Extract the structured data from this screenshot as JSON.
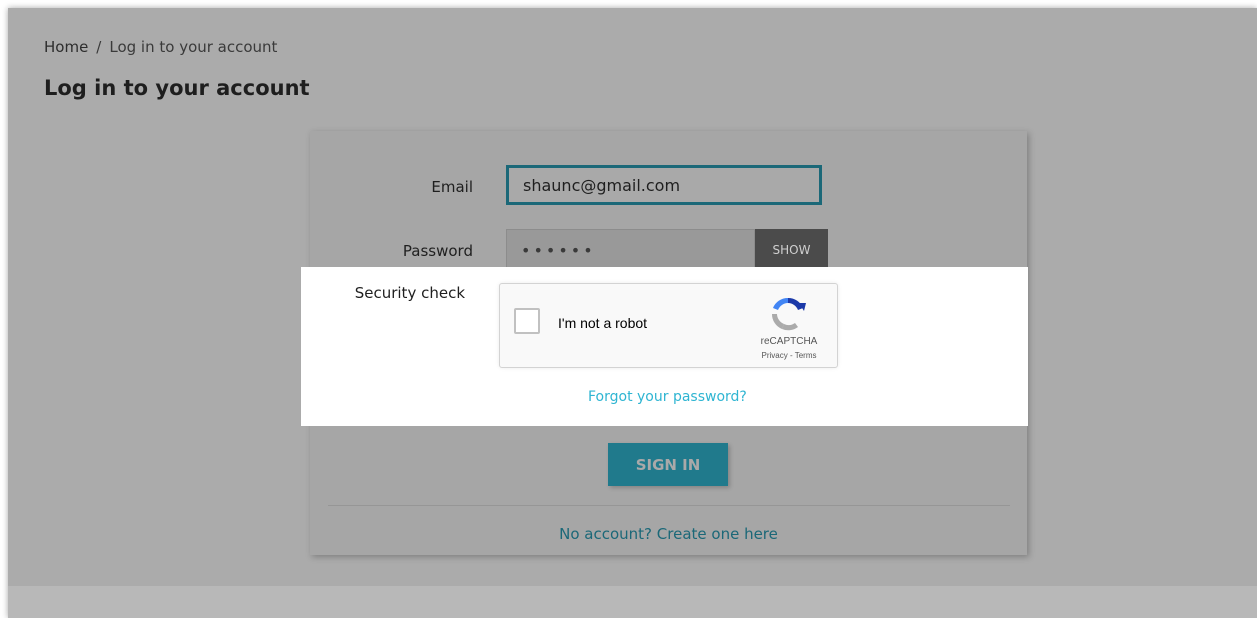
{
  "breadcrumb": {
    "home": "Home",
    "separator": "/",
    "current": "Log in to your account"
  },
  "page_title": "Log in to your account",
  "form": {
    "email_label": "Email",
    "email_value": "shaunc@gmail.com",
    "password_label": "Password",
    "password_value": "••••••",
    "show_label": "SHOW",
    "security_label": "Security check",
    "forgot_link": "Forgot your password?",
    "signin_label": "SIGN IN",
    "create_link": "No account? Create one here"
  },
  "recaptcha": {
    "checkbox_label": "I'm not a robot",
    "brand": "reCAPTCHA",
    "links": "Privacy - Terms",
    "icon": "recaptcha-logo-icon"
  },
  "colors": {
    "accent": "#2fb5d2",
    "signin_bg": "#207a8c",
    "overlay": "#ababab"
  }
}
